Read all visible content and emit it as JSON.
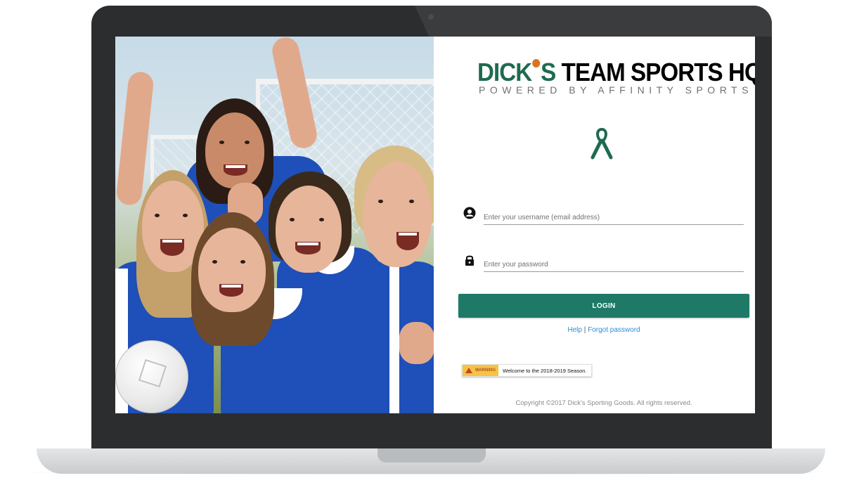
{
  "logo": {
    "brand": "DICK",
    "brand_suffix": "S",
    "title_rest": "TEAM SPORTS HQ",
    "tagline": "POWERED BY AFFINITY SPORTS"
  },
  "login": {
    "username_placeholder": "Enter your username (email address)",
    "password_placeholder": "Enter your password",
    "login_label": "LOGIN",
    "help_label": "Help",
    "separator": "|",
    "forgot_label": "Forgot password"
  },
  "notice": {
    "badge": "WARNING",
    "message": "Welcome to the 2018-2019 Season."
  },
  "footer": {
    "copyright": "Copyright ©2017 Dick's Sporting Goods. All rights reserved."
  },
  "colors": {
    "accent": "#1e7a67",
    "brand_green": "#1f6b4f",
    "link": "#2a8fd0",
    "warning": "#f6c344"
  },
  "icons": {
    "ribbon": "awareness-ribbon-icon",
    "user": "account-circle-icon",
    "lock": "lock-icon",
    "warning": "warning-triangle-icon"
  }
}
